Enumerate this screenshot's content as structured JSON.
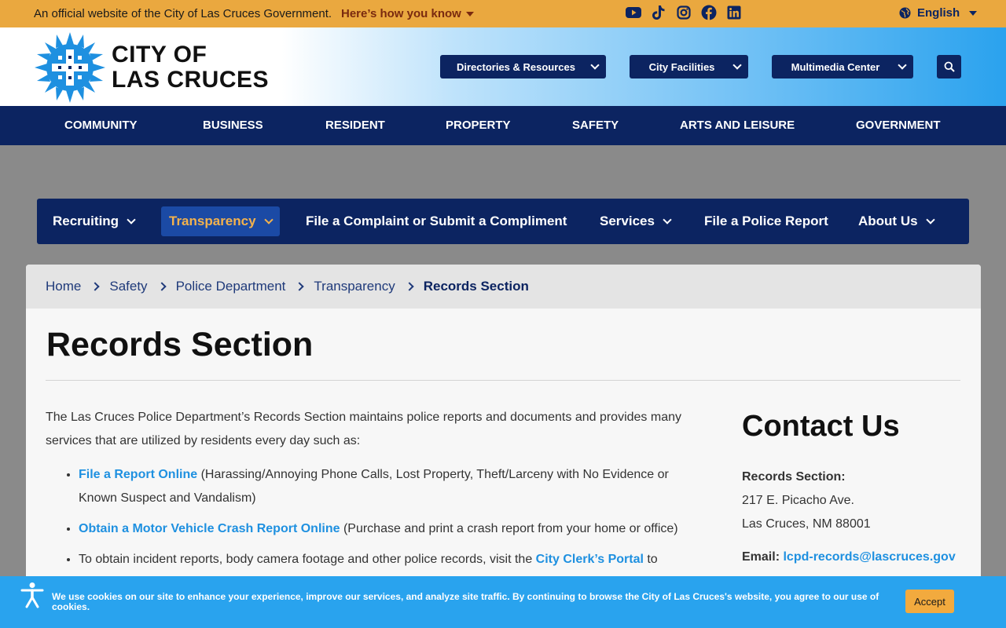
{
  "official_bar": {
    "text": "An official website of the City of Las Cruces Government.",
    "link": "Here’s how you know",
    "socials": [
      "youtube-icon",
      "tiktok-icon",
      "instagram-icon",
      "facebook-icon",
      "linkedin-icon"
    ],
    "language": "English"
  },
  "header": {
    "logo_line1": "CITY OF",
    "logo_line2": "LAS CRUCES",
    "dropdowns": [
      "Directories & Resources",
      "City Facilities",
      "Multimedia Center"
    ]
  },
  "main_nav": [
    "COMMUNITY",
    "BUSINESS",
    "RESIDENT",
    "PROPERTY",
    "SAFETY",
    "ARTS AND LEISURE",
    "GOVERNMENT"
  ],
  "sub_nav": {
    "recruiting": "Recruiting",
    "transparency": "Transparency",
    "complaint": "File a Complaint or Submit a Compliment",
    "services": "Services",
    "police_report": "File a Police Report",
    "about": "About Us"
  },
  "breadcrumb": [
    "Home",
    "Safety",
    "Police Department",
    "Transparency",
    "Records Section"
  ],
  "page_title": "Records Section",
  "intro": "The Las Cruces Police Department’s Records Section maintains police reports and documents and provides many services that are utilized by residents every day such as:",
  "list": [
    {
      "link": "File a Report Online",
      "text": " (Harassing/Annoying Phone Calls, Lost Property, Theft/Larceny with No Evidence or Known Suspect and Vandalism)"
    },
    {
      "link": "Obtain a Motor Vehicle Crash Report Online",
      "text": " (Purchase and print a crash report from your home or office)"
    },
    {
      "prefix": "To obtain incident reports, body camera footage and other police records, visit the ",
      "link": "City Clerk’s Portal",
      "text": " to"
    }
  ],
  "contact": {
    "title": "Contact Us",
    "label": "Records Section:",
    "address1": "217 E. Picacho Ave.",
    "address2": "Las Cruces, NM 88001",
    "email_label": "Email:",
    "email": "lcpd-records@lascruces.gov"
  },
  "cookie": {
    "text": "We use cookies on our site to enhance your experience, improve our services, and analyze site traffic. By continuing to browse the City of Las Cruces's website, you agree to our use of cookies.",
    "accept": "Accept"
  },
  "colors": {
    "gold": "#eaa83f",
    "navy": "#0c2461",
    "link_blue": "#1e90e0",
    "cookie_blue": "#29a3ee"
  }
}
